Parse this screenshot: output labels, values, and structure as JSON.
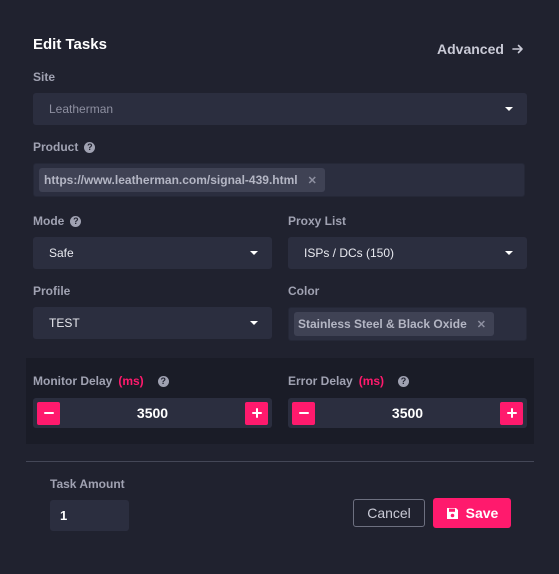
{
  "dialog": {
    "title": "Edit Tasks",
    "advanced_label": "Advanced"
  },
  "site": {
    "label": "Site",
    "value": "Leatherman"
  },
  "product": {
    "label": "Product",
    "tag": "https://www.leatherman.com/signal-439.html"
  },
  "mode": {
    "label": "Mode",
    "value": "Safe"
  },
  "proxy_list": {
    "label": "Proxy List",
    "value": "ISPs / DCs (150)"
  },
  "profile": {
    "label": "Profile",
    "value": "TEST"
  },
  "color": {
    "label": "Color",
    "tag": "Stainless Steel & Black Oxide"
  },
  "monitor_delay": {
    "label": "Monitor Delay",
    "unit": "(ms)",
    "value": "3500"
  },
  "error_delay": {
    "label": "Error Delay",
    "unit": "(ms)",
    "value": "3500"
  },
  "task_amount": {
    "label": "Task Amount",
    "value": "1"
  },
  "footer": {
    "cancel_label": "Cancel",
    "save_label": "Save"
  },
  "colors": {
    "background": "#20222f",
    "field": "#2b2e3f",
    "accent": "#ff1a6d"
  },
  "icons": [
    "arrow-right-icon",
    "help-icon",
    "caret-down-icon",
    "tag-remove-icon",
    "minus-icon",
    "plus-icon",
    "floppy-disk-icon"
  ]
}
